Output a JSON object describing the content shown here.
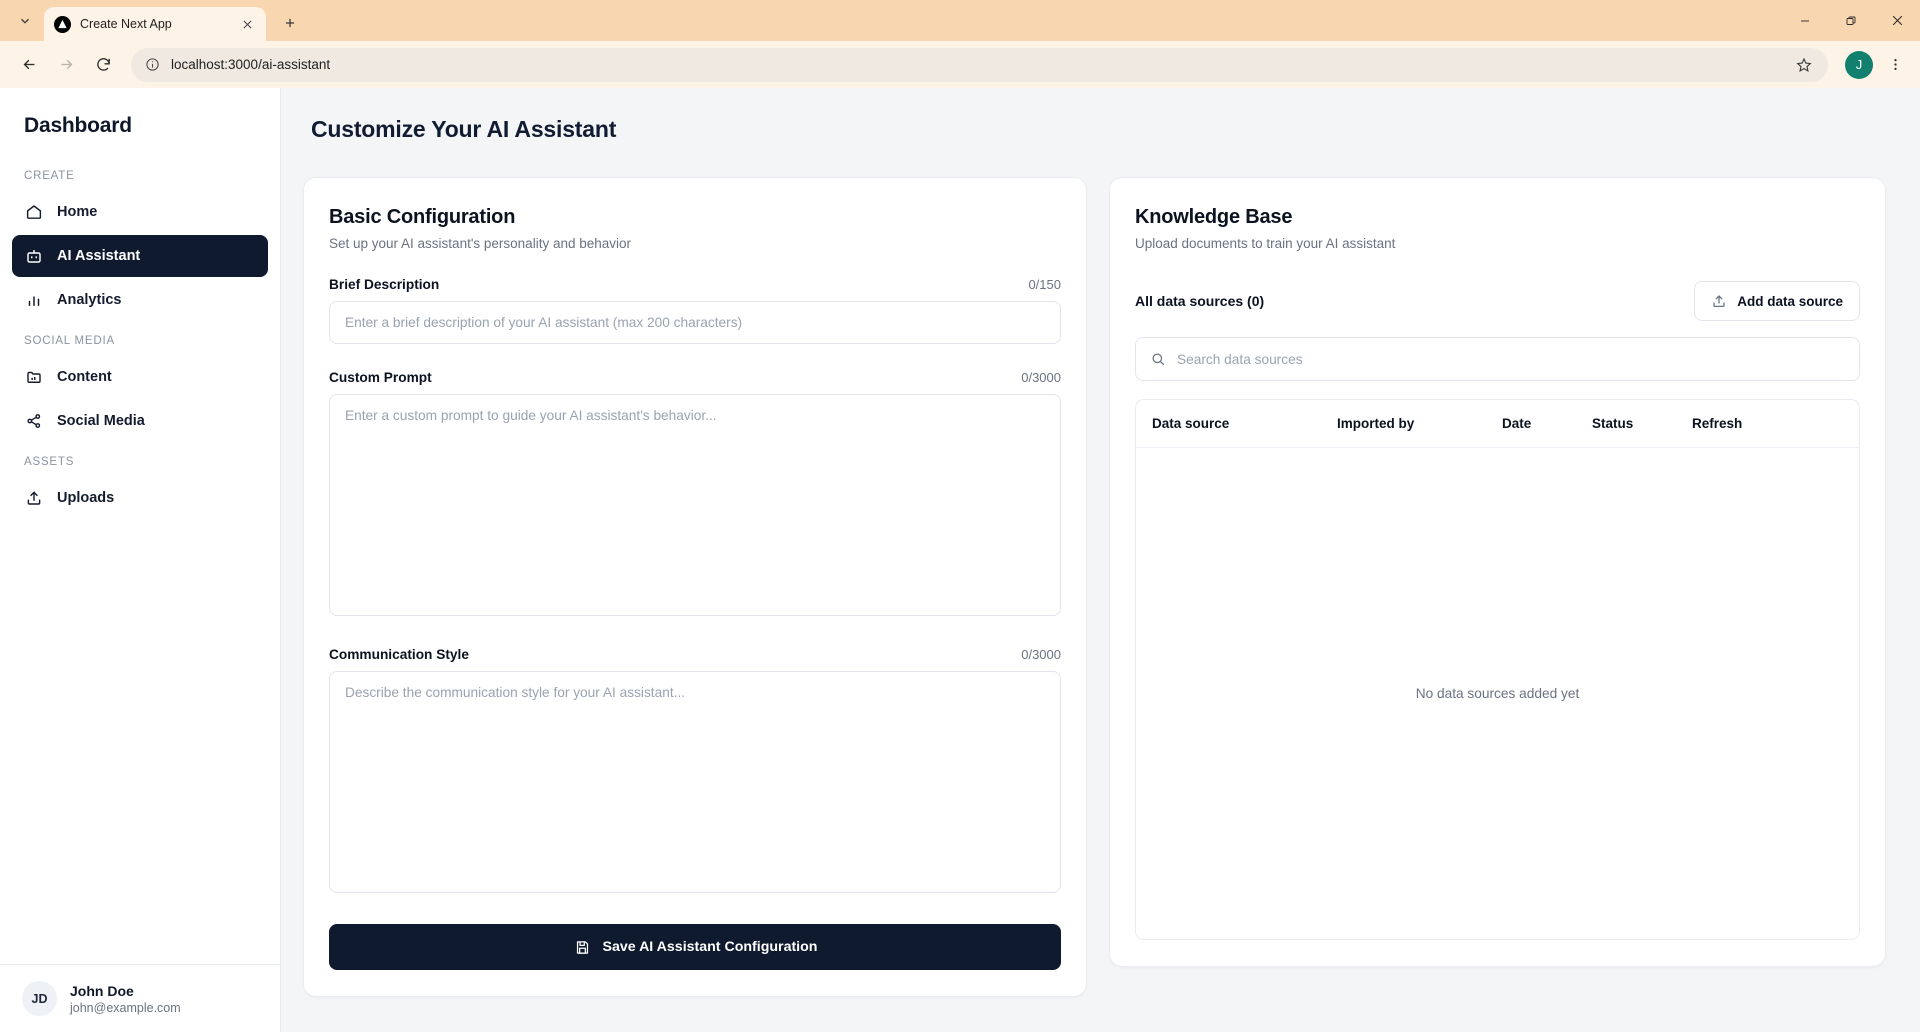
{
  "browser": {
    "tab": {
      "title": "Create Next App",
      "favicon": "nextjs-logo-icon",
      "close": "close-icon"
    },
    "new_tab": "new-tab-icon",
    "tab_list_dropdown": "chevron-down-icon",
    "window": {
      "minimize": "minimize-icon",
      "maximize": "restore-icon",
      "close": "close-icon"
    },
    "nav": {
      "back": "back-arrow-icon",
      "forward": "forward-arrow-icon",
      "reload": "reload-icon"
    },
    "omnibox": {
      "url": "localhost:3000/ai-assistant",
      "info_icon": "site-info-icon",
      "bookmark_icon": "star-icon"
    },
    "profile_initial": "J",
    "menu": "kebab-menu-icon",
    "accent_tab_bar": "#f8d6b0",
    "profile_color": "#11806e"
  },
  "sidebar": {
    "brand": "Dashboard",
    "sections": [
      {
        "label": "CREATE",
        "items": [
          {
            "label": "Home",
            "icon": "home-icon",
            "active": false
          },
          {
            "label": "AI Assistant",
            "icon": "bot-icon",
            "active": true
          },
          {
            "label": "Analytics",
            "icon": "bar-chart-icon",
            "active": false
          }
        ]
      },
      {
        "label": "SOCIAL MEDIA",
        "items": [
          {
            "label": "Content",
            "icon": "folder-icon",
            "active": false
          },
          {
            "label": "Social Media",
            "icon": "share-icon",
            "active": false
          }
        ]
      },
      {
        "label": "ASSETS",
        "items": [
          {
            "label": "Uploads",
            "icon": "upload-icon",
            "active": false
          }
        ]
      }
    ],
    "user": {
      "initials": "JD",
      "name": "John Doe",
      "email": "john@example.com"
    },
    "active_bg": "#101a2e"
  },
  "main": {
    "page_title": "Customize Your AI Assistant",
    "basic_config": {
      "title": "Basic Configuration",
      "subtitle": "Set up your AI assistant's personality and behavior",
      "fields": [
        {
          "label": "Brief Description",
          "counter": "0/150",
          "value": "",
          "placeholder": "Enter a brief description of your AI assistant (max 200 characters)"
        },
        {
          "label": "Custom Prompt",
          "counter": "0/3000",
          "value": "",
          "placeholder": "Enter a custom prompt to guide your AI assistant's behavior..."
        },
        {
          "label": "Communication Style",
          "counter": "0/3000",
          "value": "",
          "placeholder": "Describe the communication style for your AI assistant..."
        }
      ],
      "save_label": "Save AI Assistant Configuration",
      "save_icon": "save-disk-icon"
    },
    "knowledge_base": {
      "title": "Knowledge Base",
      "subtitle": "Upload documents to train your AI assistant",
      "count_label": "All data sources (0)",
      "add_label": "Add data source",
      "add_icon": "upload-icon",
      "search_placeholder": "Search data sources",
      "search_value": "",
      "search_icon": "search-icon",
      "columns": [
        "Data source",
        "Imported by",
        "Date",
        "Status",
        "Refresh"
      ],
      "rows": [],
      "empty_text": "No data sources added yet"
    }
  }
}
